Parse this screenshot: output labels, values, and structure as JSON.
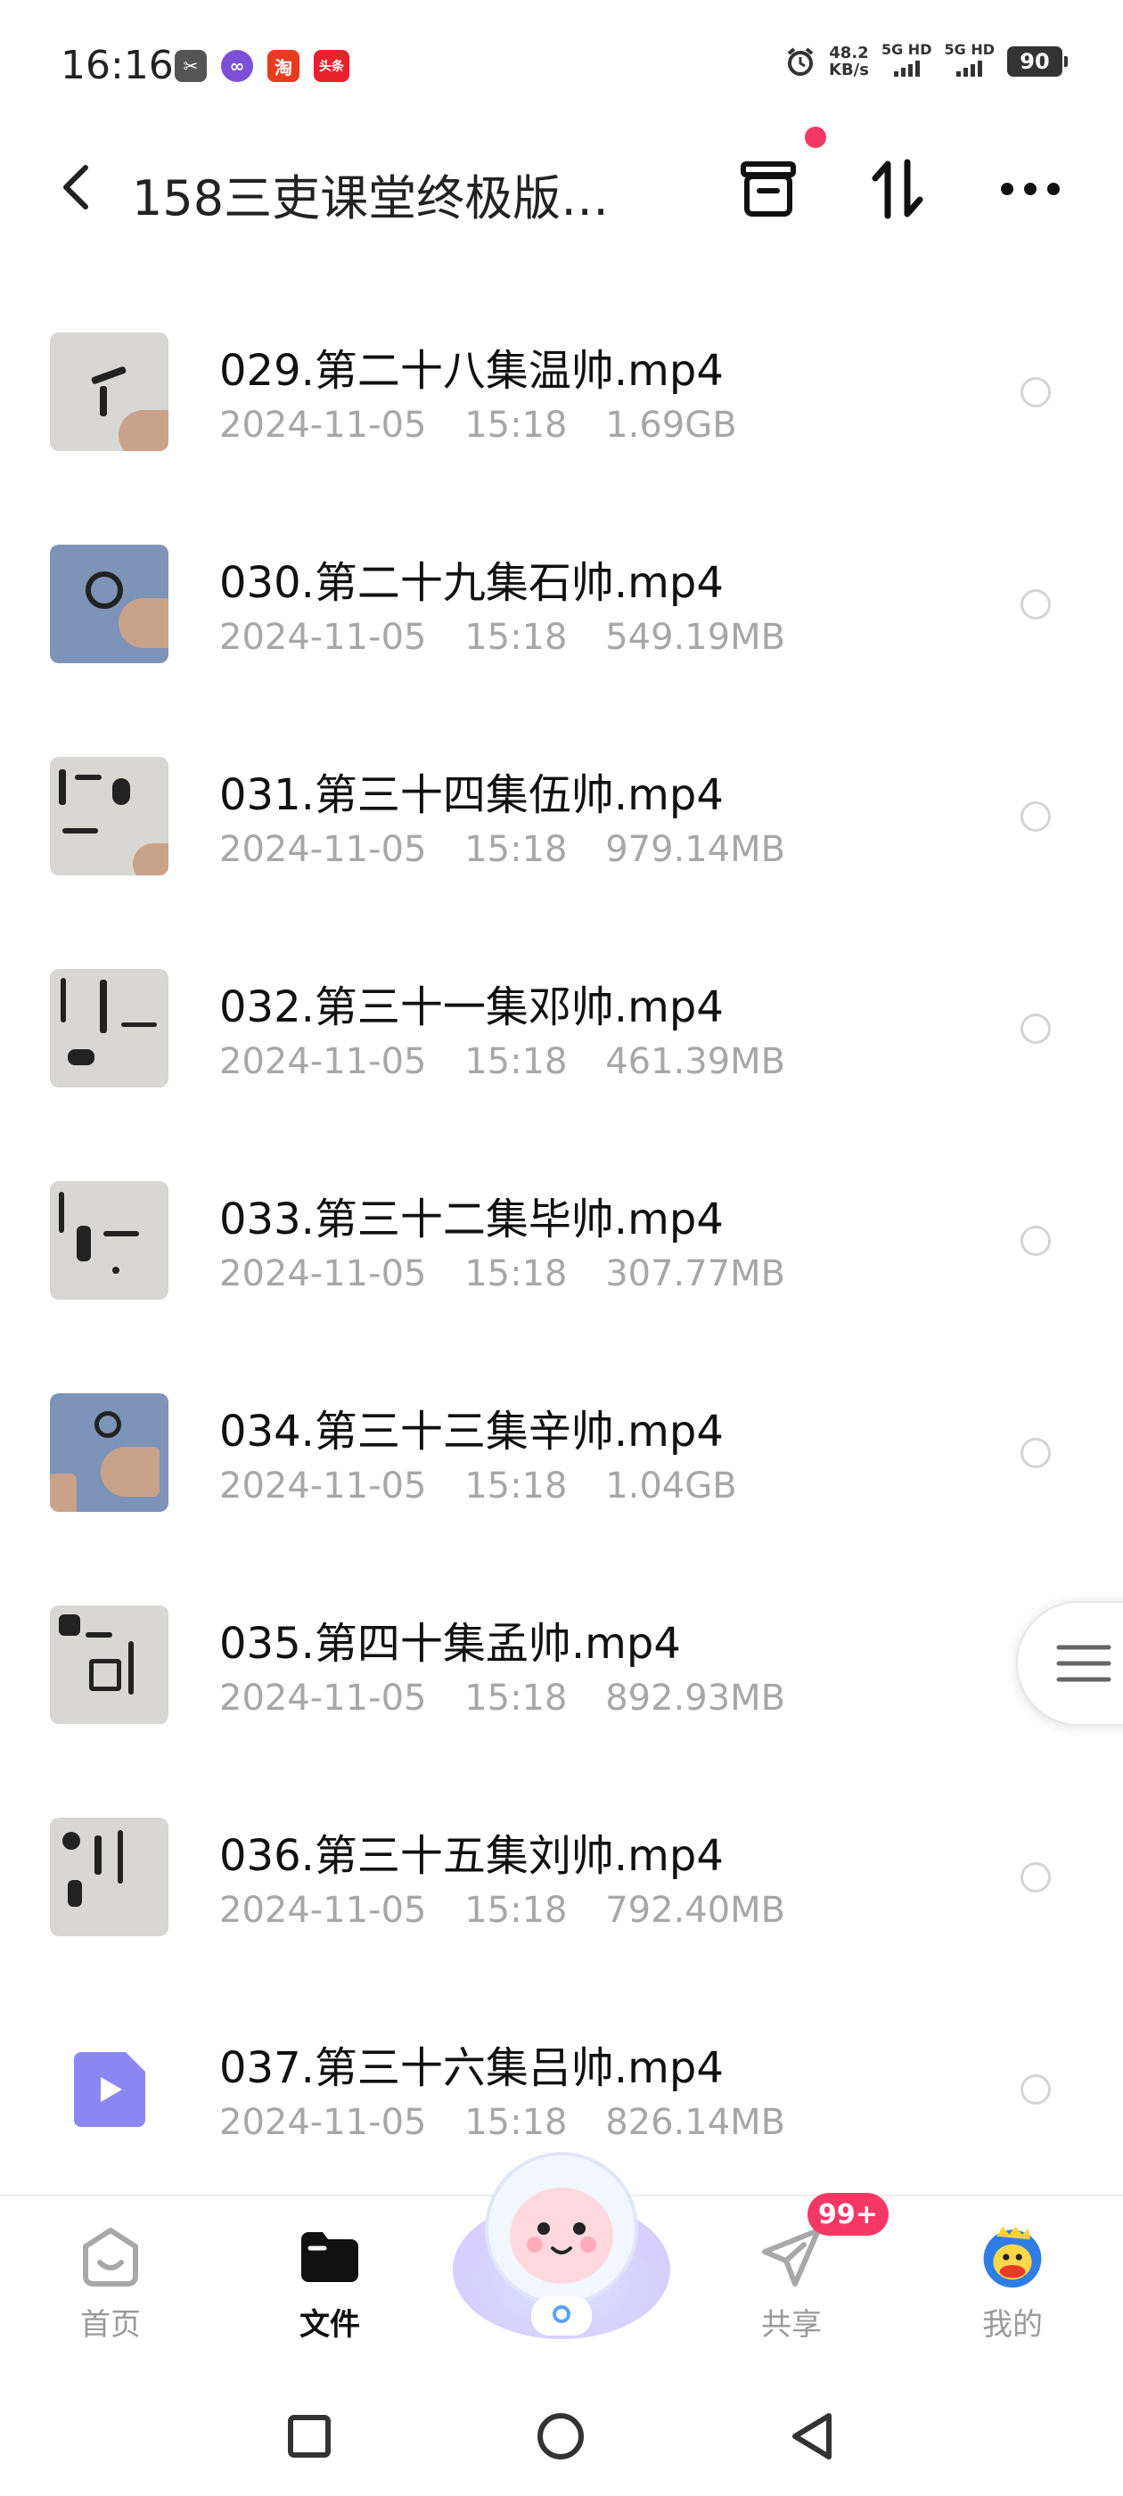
{
  "status_bar": {
    "time": "16:16",
    "net_speed_value": "48.2",
    "net_speed_unit": "KB/s",
    "network_1": "5G HD",
    "network_2": "5G HD",
    "battery": "90",
    "app_icons": [
      "scissors-app-icon",
      "link-app-icon",
      "taobao-app-icon",
      "toutiao-app-icon"
    ],
    "taobao_label": "淘",
    "toutiao_label": "头条"
  },
  "header": {
    "title": "158三吏课堂终极版…",
    "has_notification_dot": true
  },
  "files": [
    {
      "name": "029.第二十八集温帅.mp4",
      "date": "2024-11-05",
      "time": "15:18",
      "size": "1.69GB"
    },
    {
      "name": "030.第二十九集石帅.mp4",
      "date": "2024-11-05",
      "time": "15:18",
      "size": "549.19MB"
    },
    {
      "name": "031.第三十四集伍帅.mp4",
      "date": "2024-11-05",
      "time": "15:18",
      "size": "979.14MB"
    },
    {
      "name": "032.第三十一集邓帅.mp4",
      "date": "2024-11-05",
      "time": "15:18",
      "size": "461.39MB"
    },
    {
      "name": "033.第三十二集毕帅.mp4",
      "date": "2024-11-05",
      "time": "15:18",
      "size": "307.77MB"
    },
    {
      "name": "034.第三十三集辛帅.mp4",
      "date": "2024-11-05",
      "time": "15:18",
      "size": "1.04GB"
    },
    {
      "name": "035.第四十集孟帅.mp4",
      "date": "2024-11-05",
      "time": "15:18",
      "size": "892.93MB"
    },
    {
      "name": "036.第三十五集刘帅.mp4",
      "date": "2024-11-05",
      "time": "15:18",
      "size": "792.40MB"
    },
    {
      "name": "037.第三十六集吕帅.mp4",
      "date": "2024-11-05",
      "time": "15:18",
      "size": "826.14MB"
    }
  ],
  "bottom_nav": {
    "items": [
      {
        "label": "首页",
        "icon": "home-icon",
        "active": false
      },
      {
        "label": "文件",
        "icon": "folder-icon",
        "active": true
      },
      {
        "label": "共享",
        "icon": "share-icon",
        "active": false,
        "badge": "99+"
      },
      {
        "label": "我的",
        "icon": "profile-avatar-icon",
        "active": false
      }
    ]
  },
  "colors": {
    "accent_pink": "#f43866",
    "meta_gray": "#a7a7a7",
    "video_icon_purple": "#8b87f2"
  }
}
